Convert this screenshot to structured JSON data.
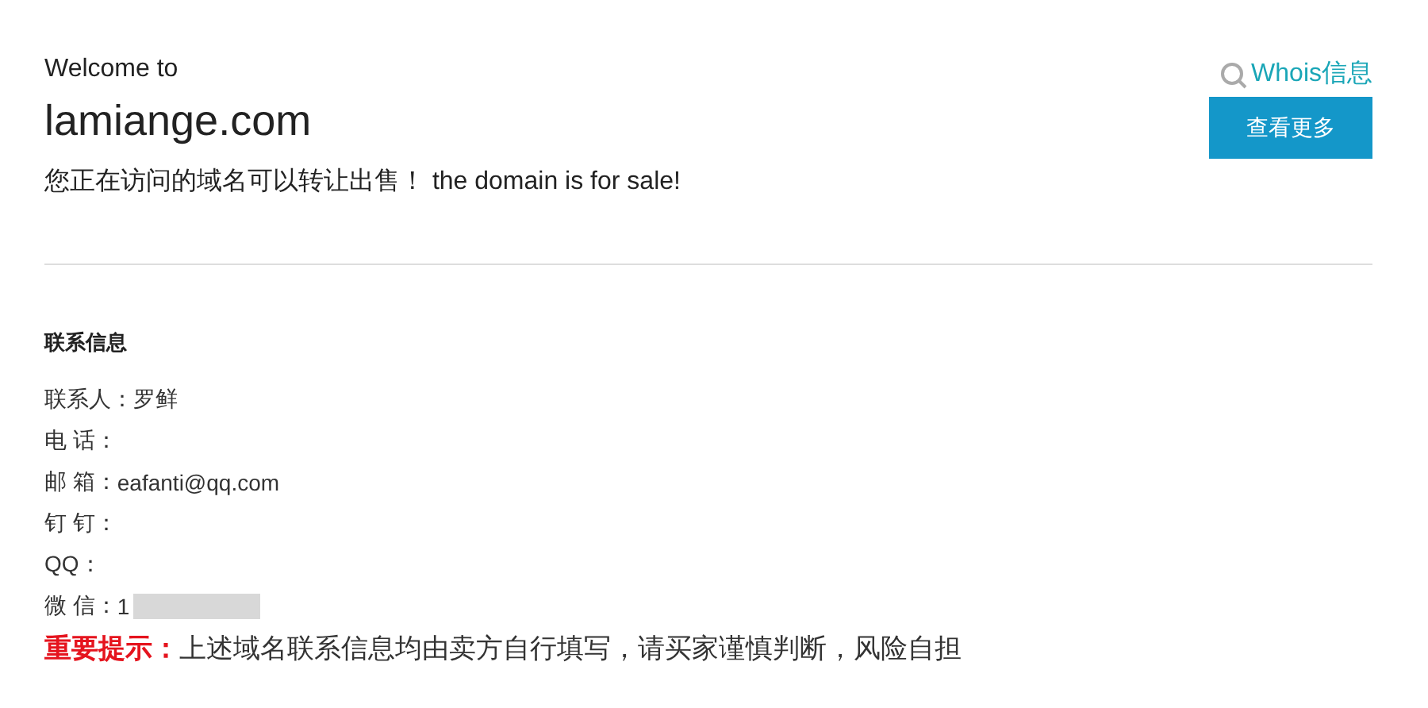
{
  "header": {
    "welcome": "Welcome to",
    "domain": "lamiange.com",
    "sale_text": "您正在访问的域名可以转让出售！ the domain is for sale!",
    "whois_link": "Whois信息",
    "more_button": "查看更多"
  },
  "contact": {
    "title": "联系信息",
    "rows": [
      {
        "label": "联系人：",
        "value": "罗鲜",
        "redacted": false
      },
      {
        "label": "电 话：",
        "redacted": false
      },
      {
        "label": "邮 箱：",
        "value": "eafanti@qq.com",
        "redacted": false
      },
      {
        "label": "钉 钉：",
        "redacted": false
      },
      {
        "label": "QQ：",
        "redacted": false
      },
      {
        "label": "微 信：",
        "value": "1",
        "redacted": true
      }
    ]
  },
  "notice": {
    "label": "重要提示：",
    "text": "上述域名联系信息均由卖方自行填写，请买家谨慎判断，风险自担"
  }
}
